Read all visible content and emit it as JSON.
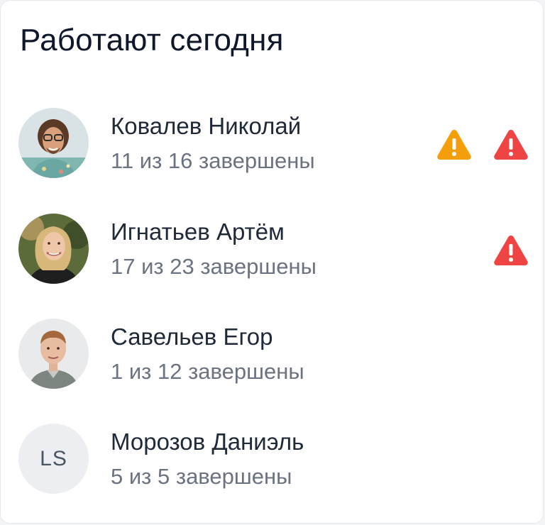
{
  "widget": {
    "title": "Работают сегодня"
  },
  "colors": {
    "warning_orange": "#f59e0b",
    "warning_red": "#ef4444",
    "title_text": "#0f172a",
    "secondary_text": "#6b7280"
  },
  "employees": [
    {
      "name": "Ковалев Николай",
      "progress": "11 из 16 завершены",
      "avatar_type": "photo",
      "warnings": [
        "warning-orange-icon",
        "warning-red-icon"
      ]
    },
    {
      "name": "Игнатьев Артём",
      "progress": "17 из 23 завершены",
      "avatar_type": "photo",
      "warnings": [
        "warning-red-icon"
      ]
    },
    {
      "name": "Савельев Егор",
      "progress": "1 из 12 завершены",
      "avatar_type": "photo",
      "warnings": []
    },
    {
      "name": "Морозов Даниэль",
      "progress": "5 из 5 завершены",
      "avatar_type": "initials",
      "initials": "LS",
      "warnings": []
    }
  ]
}
